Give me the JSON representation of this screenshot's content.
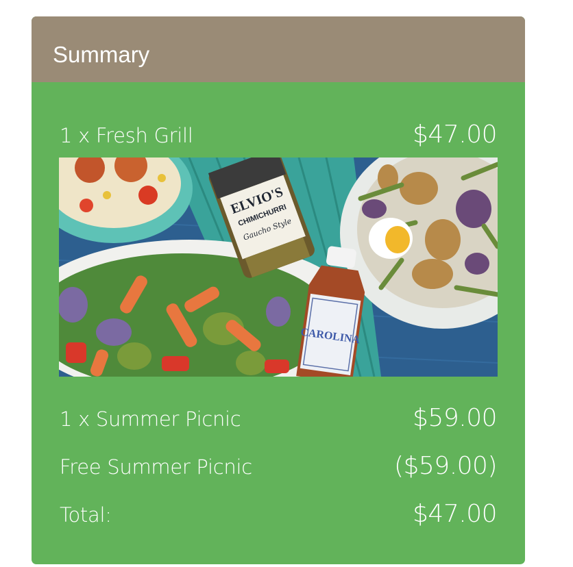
{
  "summary": {
    "title": "Summary",
    "colors": {
      "header_bg": "#9a8b76",
      "body_bg": "#62b35a",
      "text": "#ffffff"
    },
    "items": [
      {
        "label": "1 x Fresh Grill",
        "price": "$47.00"
      },
      {
        "label": "1 x Summer Picnic",
        "price": "$59.00"
      },
      {
        "label": "Free Summer Picnic",
        "price": "($59.00)"
      }
    ],
    "total": {
      "label": "Total:",
      "price": "$47.00"
    },
    "image": {
      "jar_brand": "ELVIO'S",
      "jar_product": "CHIMICHURRI",
      "jar_style": "Gaucho Style",
      "bottle_label": "CAROLINA"
    }
  }
}
